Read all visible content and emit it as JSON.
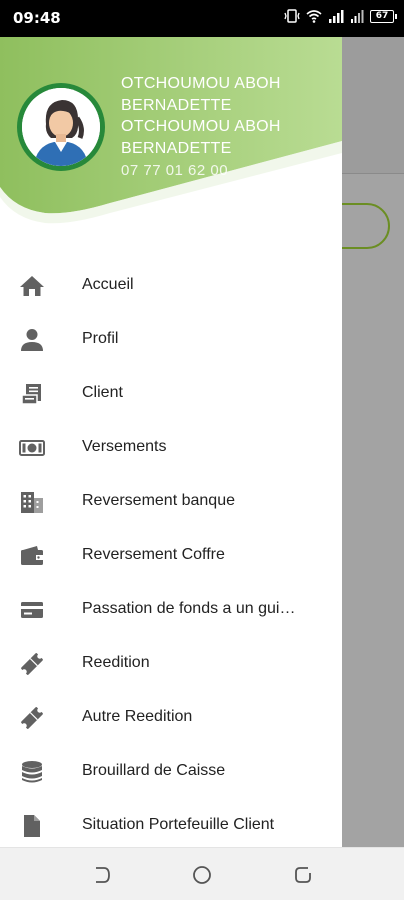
{
  "status_bar": {
    "time": "09:48",
    "battery": "67",
    "icons": [
      "vibrate-icon",
      "wifi-icon",
      "signal-icon",
      "signal-icon-2",
      "battery-icon"
    ]
  },
  "drawer": {
    "user": {
      "name": "OTCHOUMOU ABOH BERNADETTE OTCHOUMOU ABOH BERNADETTE",
      "phone": "07 77 01 62 00"
    },
    "items": [
      {
        "label": "Accueil",
        "icon": "home-icon"
      },
      {
        "label": "Profil",
        "icon": "person-icon"
      },
      {
        "label": "Client",
        "icon": "receipt-icon"
      },
      {
        "label": "Versements",
        "icon": "money-icon"
      },
      {
        "label": "Reversement banque",
        "icon": "bank-building-icon"
      },
      {
        "label": "Reversement Coffre",
        "icon": "wallet-icon"
      },
      {
        "label": "Passation de fonds a un gui…",
        "icon": "card-icon"
      },
      {
        "label": "Reedition",
        "icon": "ticket-icon"
      },
      {
        "label": "Autre Reedition",
        "icon": "ticket-icon"
      },
      {
        "label": "Brouillard de Caisse",
        "icon": "database-icon"
      },
      {
        "label": "Situation Portefeuille Client",
        "icon": "document-icon"
      }
    ]
  },
  "colors": {
    "header_green": "#a9cf84",
    "avatar_ring": "#27893a",
    "icon_gray": "#616161",
    "background_pill_border": "#6b8e23"
  },
  "navbar": {
    "buttons": [
      "back-button",
      "home-button",
      "recents-button"
    ]
  }
}
